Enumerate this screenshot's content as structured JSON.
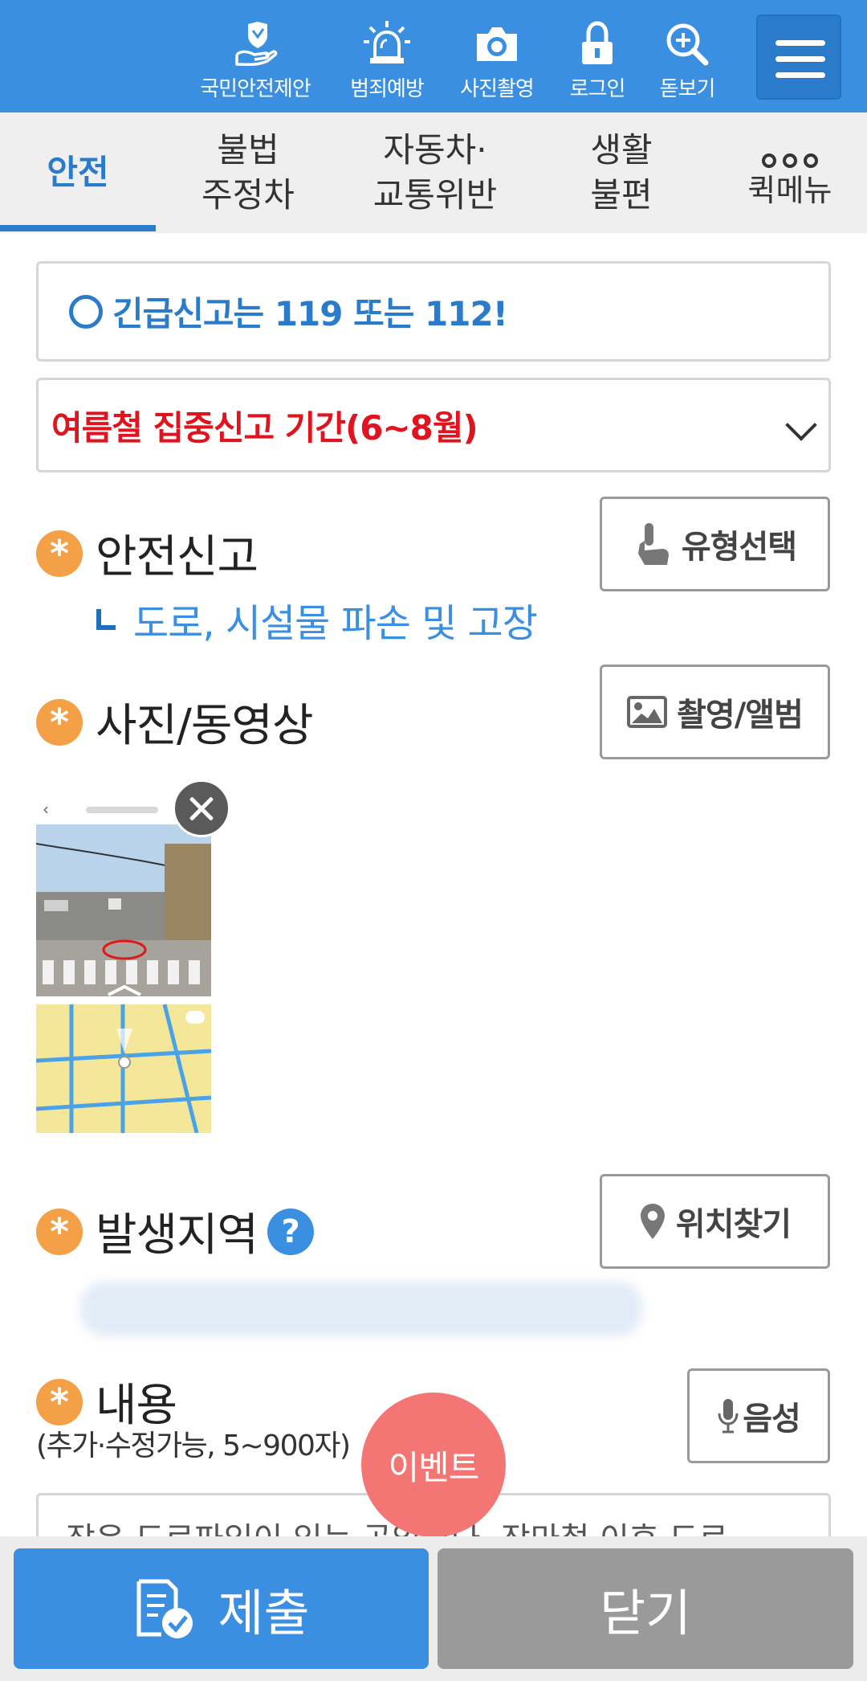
{
  "header": {
    "items": [
      {
        "label": "국민안전제안",
        "icon": "hand-shield-icon"
      },
      {
        "label": "범죄예방",
        "icon": "siren-icon"
      },
      {
        "label": "사진촬영",
        "icon": "camera-icon"
      },
      {
        "label": "로그인",
        "icon": "lock-icon"
      },
      {
        "label": "돋보기",
        "icon": "magnifier-plus-icon"
      }
    ],
    "menu_icon": "hamburger-menu-icon"
  },
  "tabs": [
    {
      "label": "안전",
      "active": true
    },
    {
      "label": "불법\n주정차",
      "active": false
    },
    {
      "label": "자동차·\n교통위반",
      "active": false
    },
    {
      "label": "생활\n불편",
      "active": false
    },
    {
      "label": "퀵메뉴",
      "active": false,
      "icon": "more-dots-icon"
    }
  ],
  "emergency_notice": "긴급신고는 119 또는 112!",
  "campaign_select": "여름철 집중신고 기간(6~8월)",
  "report_type": {
    "title": "안전신고",
    "subcategory": "도로, 시설물 파손 및 고장",
    "button": "유형선택"
  },
  "media": {
    "title": "사진/동영상",
    "button": "촬영/앨범"
  },
  "location": {
    "title": "발생지역",
    "help": "?",
    "button": "위치찾기"
  },
  "content": {
    "title": "내용",
    "note": "(추가·수정가능, 5~900자)",
    "voice_button": "음성",
    "text": "잦은 도로파임이 있는 곳입니다. 장마철 이후 도로"
  },
  "event_badge": "이벤트",
  "bottom": {
    "submit": "제출",
    "close": "닫기"
  },
  "colors": {
    "primary": "#3a8fe0",
    "accent_red": "#e0141e",
    "required_star": "#f3a046",
    "event": "#f47674",
    "close_button": "#9a9a9a"
  }
}
